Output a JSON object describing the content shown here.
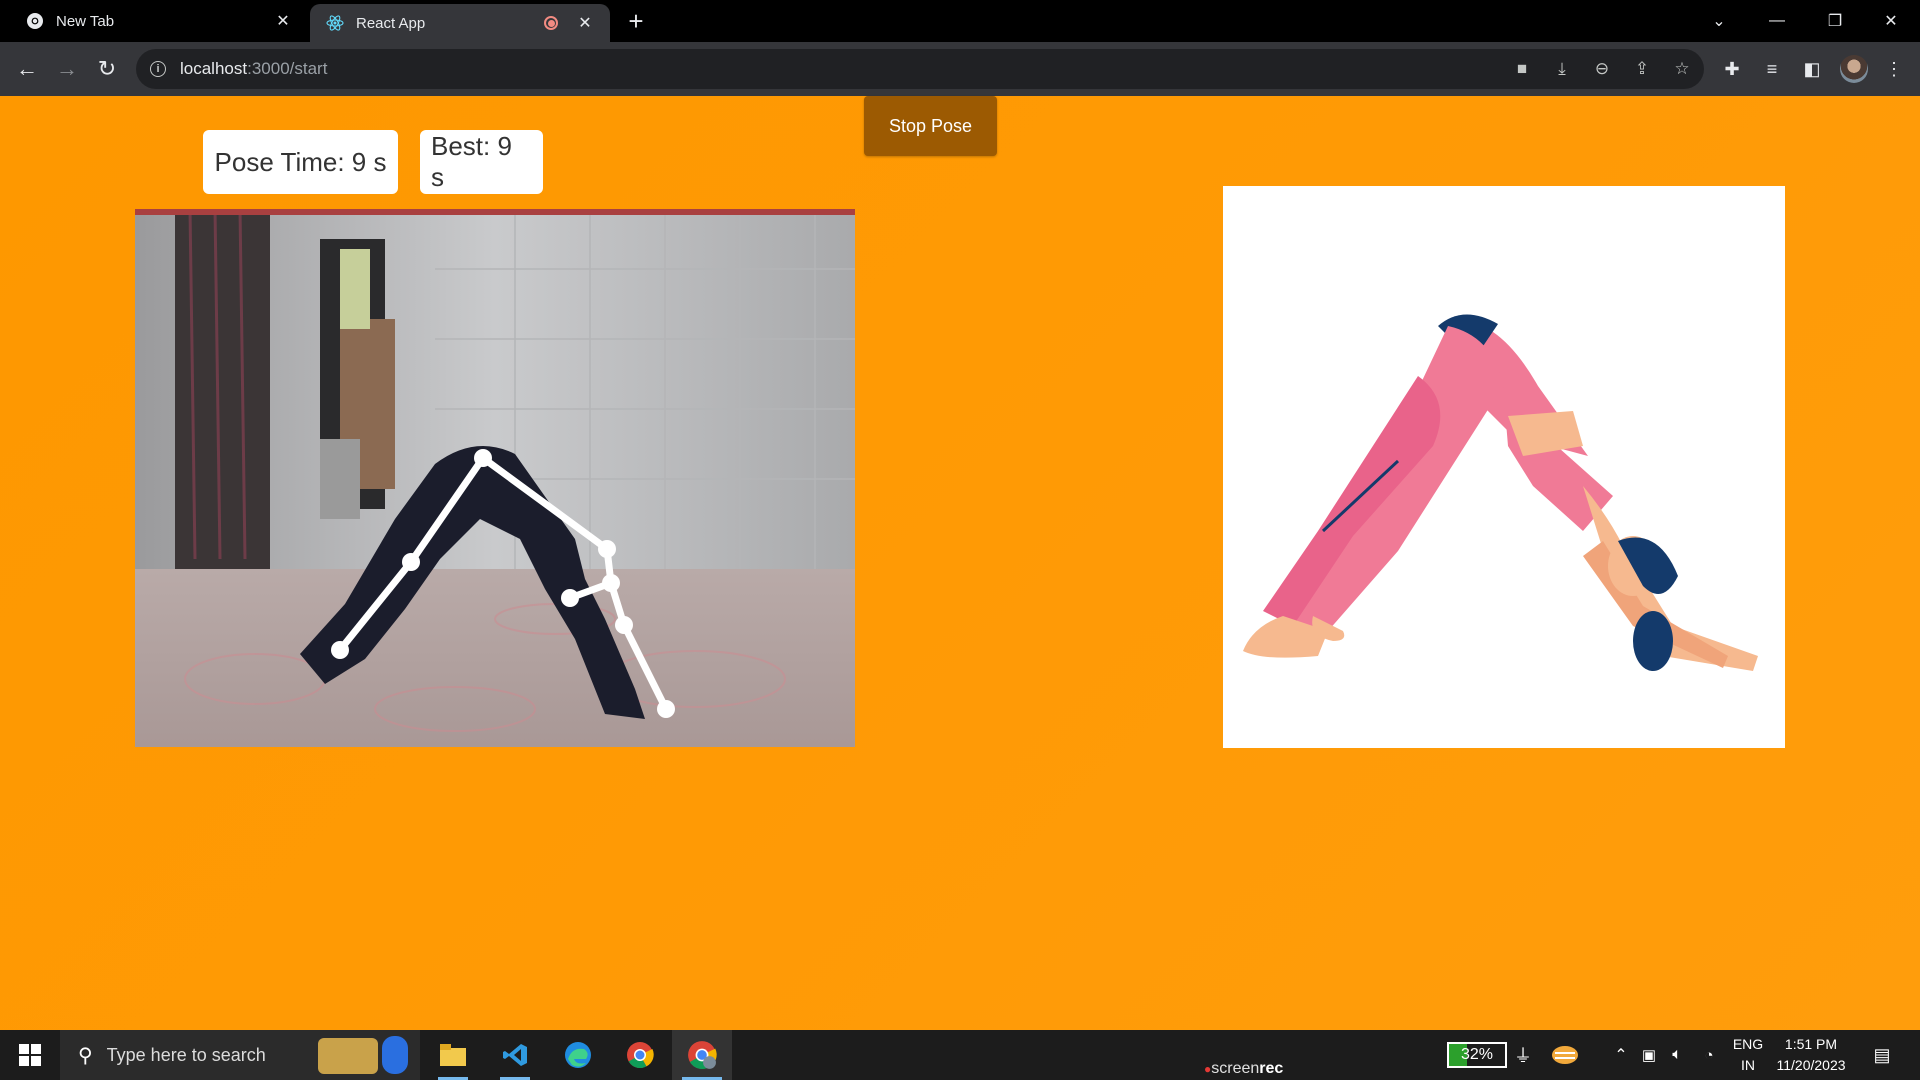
{
  "browser": {
    "tabs": [
      {
        "title": "New Tab",
        "active": false
      },
      {
        "title": "React App",
        "active": true,
        "recording": true
      }
    ],
    "url": {
      "host": "localhost",
      "path": ":3000/start"
    }
  },
  "app": {
    "stop_button": "Stop Pose",
    "pose_time": "Pose Time: 9 s",
    "best": "Best: 9 s"
  },
  "taskbar": {
    "search_placeholder": "Type here to search",
    "battery": "32%",
    "lang_top": "ENG",
    "lang_bottom": "IN",
    "time": "1:51 PM",
    "date": "11/20/2023",
    "watermark_prefix": "screen",
    "watermark_bold": "rec"
  },
  "colors": {
    "page_bg": "#fe9800",
    "stop_button_bg": "#9c5a02",
    "skeleton": "#ffffff"
  }
}
